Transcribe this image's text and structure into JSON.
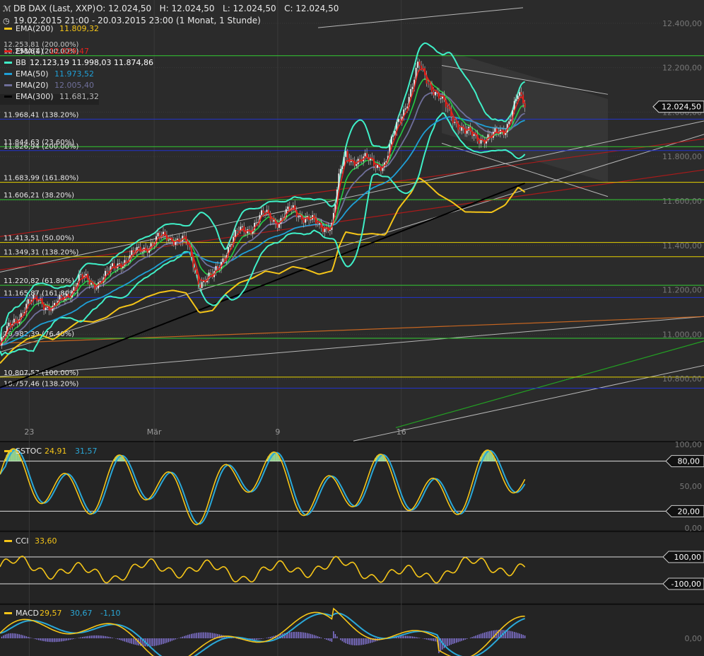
{
  "header": {
    "symbol": "DB DAX (Last, XXP)",
    "ohlc": "O: 12.024,50   H: 12.024,50   L: 12.024,50   C: 12.024,50",
    "range": "19.02.2015 21:00 - 20.03.2015 23:00 (1 Monat, 1 Stunde)"
  },
  "colors": {
    "background": "#1c1c1c",
    "panel": "#2b2b2b",
    "grid": "#3a3a3a",
    "ema200": "#f5c518",
    "ema4": "#e3221c",
    "bb": "#3ff0c8",
    "ema50": "#1f9fd6",
    "ema20": "#6f6f9a",
    "ema300": "#000000",
    "fib_yellow": "#e6d200",
    "fib_green": "#33cc33",
    "fib_blue": "#2233cc",
    "text": "#e8e8e8",
    "axis_text": "#9a9a9a"
  },
  "legend": [
    {
      "name": "EMA(200)",
      "values": "11.809,32",
      "color": "#f5c518"
    },
    {
      "name": "EMA(4)",
      "values": "12.029,47",
      "color": "#e3221c"
    },
    {
      "name": "BB",
      "values": "12.123,19   11.998,03   11.874,86",
      "color": "#3ff0c8"
    },
    {
      "name": "EMA(50)",
      "values": "11.973,52",
      "color": "#1f9fd6"
    },
    {
      "name": "EMA(20)",
      "values": "12.005,40",
      "color": "#6f6f9a"
    },
    {
      "name": "EMA(300)",
      "values": "11.681,32",
      "color": "#000000"
    }
  ],
  "overlap_label": "12.253,81 (200.00%)",
  "chart_data": [
    {
      "type": "candlestick",
      "title": "DB DAX (Last, XXP)",
      "ylim": [
        10600,
        12460
      ],
      "yticks": [
        {
          "v": 12400,
          "label": "12.400,00"
        },
        {
          "v": 12200,
          "label": "12.200,00"
        },
        {
          "v": 12000,
          "label": "12.000,00"
        },
        {
          "v": 11800,
          "label": "11.800,00"
        },
        {
          "v": 11600,
          "label": "11.600,00"
        },
        {
          "v": 11400,
          "label": "11.400,00"
        },
        {
          "v": 11200,
          "label": "11.200,00"
        },
        {
          "v": 11000,
          "label": "11.000,00"
        },
        {
          "v": 10800,
          "label": "10.800,00"
        }
      ],
      "xticks": [
        {
          "label": "23",
          "x": 0.044
        },
        {
          "label": "Mär",
          "x": 0.232
        },
        {
          "label": "9",
          "x": 0.418
        },
        {
          "label": "16",
          "x": 0.604
        }
      ],
      "last_price": {
        "v": 12024.5,
        "label": "12.024,50"
      },
      "fib_levels": [
        {
          "v": 12253.81,
          "label": "12.253,81 (200.00%)",
          "color": "#33cc33"
        },
        {
          "v": 11968.41,
          "label": "11.968,41 (138.20%)",
          "color": "#2233cc"
        },
        {
          "v": 11844.63,
          "label": "11.844,63 (23.60%)",
          "color": "#33cc33"
        },
        {
          "v": 11826.94,
          "label": "11.826,94 (200.00%)",
          "color": "#2233cc"
        },
        {
          "v": 11683.99,
          "label": "11.683,99 (161.80%)",
          "color": "#e6d200"
        },
        {
          "v": 11606.21,
          "label": "11.606,21 (38.20%)",
          "color": "#33cc33"
        },
        {
          "v": 11413.51,
          "label": "11.413,51 (50.00%)",
          "color": "#e6d200"
        },
        {
          "v": 11349.31,
          "label": "11.349,31 (138.20%)",
          "color": "#e6d200"
        },
        {
          "v": 11220.82,
          "label": "11.220,82 (61.80%)",
          "color": "#33cc33"
        },
        {
          "v": 11165.87,
          "label": "11.165,87 (161.80%)",
          "color": "#2233cc"
        },
        {
          "v": 10982.39,
          "label": "10.982,39 (76.40%)",
          "color": "#33cc33"
        },
        {
          "v": 10807.57,
          "label": "10.807,57 (100.00%)",
          "color": "#e6d200"
        },
        {
          "v": 10757.46,
          "label": "10.757,46 (138.20%)",
          "color": "#2233cc"
        }
      ],
      "close_path": [
        [
          0,
          10950
        ],
        [
          0.02,
          11060
        ],
        [
          0.04,
          11130
        ],
        [
          0.06,
          11160
        ],
        [
          0.08,
          11110
        ],
        [
          0.1,
          11180
        ],
        [
          0.12,
          11250
        ],
        [
          0.14,
          11230
        ],
        [
          0.16,
          11260
        ],
        [
          0.18,
          11330
        ],
        [
          0.2,
          11350
        ],
        [
          0.22,
          11400
        ],
        [
          0.24,
          11430
        ],
        [
          0.26,
          11440
        ],
        [
          0.28,
          11410
        ],
        [
          0.3,
          11240
        ],
        [
          0.32,
          11250
        ],
        [
          0.34,
          11380
        ],
        [
          0.36,
          11460
        ],
        [
          0.38,
          11490
        ],
        [
          0.4,
          11540
        ],
        [
          0.42,
          11510
        ],
        [
          0.44,
          11560
        ],
        [
          0.46,
          11530
        ],
        [
          0.48,
          11480
        ],
        [
          0.5,
          11500
        ],
        [
          0.51,
          11690
        ],
        [
          0.52,
          11810
        ],
        [
          0.54,
          11780
        ],
        [
          0.56,
          11780
        ],
        [
          0.58,
          11760
        ],
        [
          0.6,
          11970
        ],
        [
          0.62,
          12100
        ],
        [
          0.63,
          12210
        ],
        [
          0.64,
          12170
        ],
        [
          0.66,
          12060
        ],
        [
          0.68,
          11990
        ],
        [
          0.7,
          11900
        ],
        [
          0.72,
          11890
        ],
        [
          0.74,
          11880
        ],
        [
          0.76,
          11930
        ],
        [
          0.78,
          12070
        ],
        [
          0.79,
          12024
        ]
      ]
    },
    {
      "type": "line",
      "title": "SSTOC",
      "series": [
        {
          "name": "SSTOC",
          "value": "24,91"
        },
        {
          "name": "",
          "value": "31,57"
        }
      ],
      "ylim": [
        0,
        100
      ],
      "yticks": [
        {
          "v": 100,
          "label": "100,00"
        },
        {
          "v": 50,
          "label": "50,00"
        },
        {
          "v": 0,
          "label": "0,00"
        }
      ],
      "levels": [
        {
          "v": 80,
          "label": "80,00"
        },
        {
          "v": 20,
          "label": "20,00"
        }
      ]
    },
    {
      "type": "line",
      "title": "CCI",
      "series": [
        {
          "name": "CCI",
          "value": "33,60"
        }
      ],
      "levels": [
        {
          "v": 100,
          "label": "100,00"
        },
        {
          "v": -100,
          "label": "-100,00"
        }
      ]
    },
    {
      "type": "line",
      "title": "MACD",
      "series": [
        {
          "name": "MACD",
          "value": "29,57"
        },
        {
          "name": "",
          "value": "30,67"
        },
        {
          "name": "",
          "value": "-1,10"
        }
      ],
      "yticks": [
        {
          "v": 0,
          "label": "0,00"
        }
      ]
    }
  ]
}
